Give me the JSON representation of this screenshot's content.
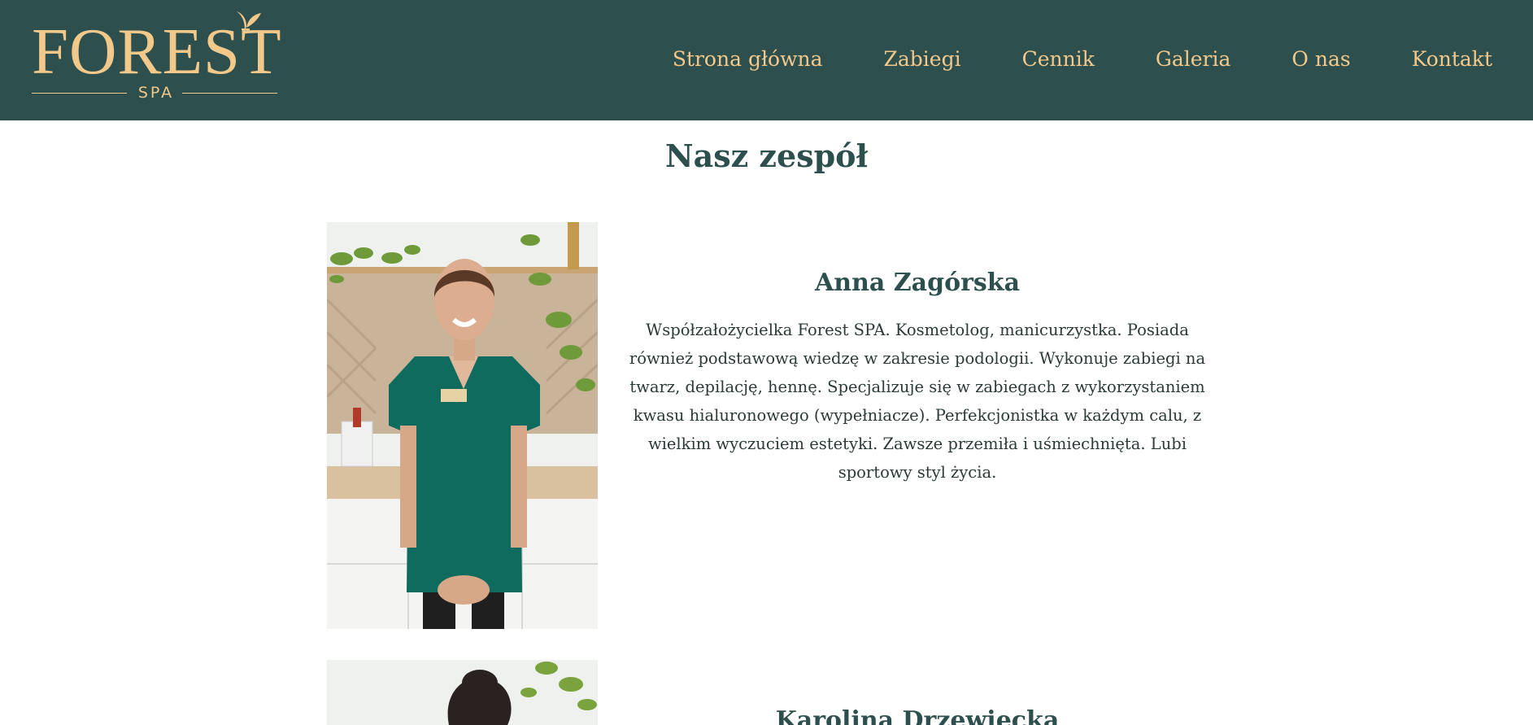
{
  "brand": {
    "name": "FOREST",
    "sub": "SPA",
    "colors": {
      "header_bg": "#2d4f4d",
      "accent": "#f3c88b",
      "heading": "#2d4f4d",
      "body_text": "#2b3a38"
    }
  },
  "nav": [
    {
      "label": "Strona główna"
    },
    {
      "label": "Zabiegi"
    },
    {
      "label": "Cennik"
    },
    {
      "label": "Galeria"
    },
    {
      "label": "O nas"
    },
    {
      "label": "Kontakt"
    }
  ],
  "team": {
    "title": "Nasz zespół",
    "members": [
      {
        "name": "Anna Zagórska",
        "bio": "Współzałożycielka Forest SPA. Kosmetolog, manicurzystka. Posiada również podstawową wiedzę w zakresie podologii. Wykonuje zabiegi na twarz, depilację, hennę. Specjalizuje się w zabiegach z wykorzystaniem kwasu hialuronowego (wypełniacze). Perfekcjonistka w każdym calu, z wielkim wyczuciem estetyki. Zawsze przemiła i uśmiechnięta. Lubi sportowy styl życia."
      },
      {
        "name": "Karolina Drzewiecka",
        "bio": ""
      }
    ]
  }
}
